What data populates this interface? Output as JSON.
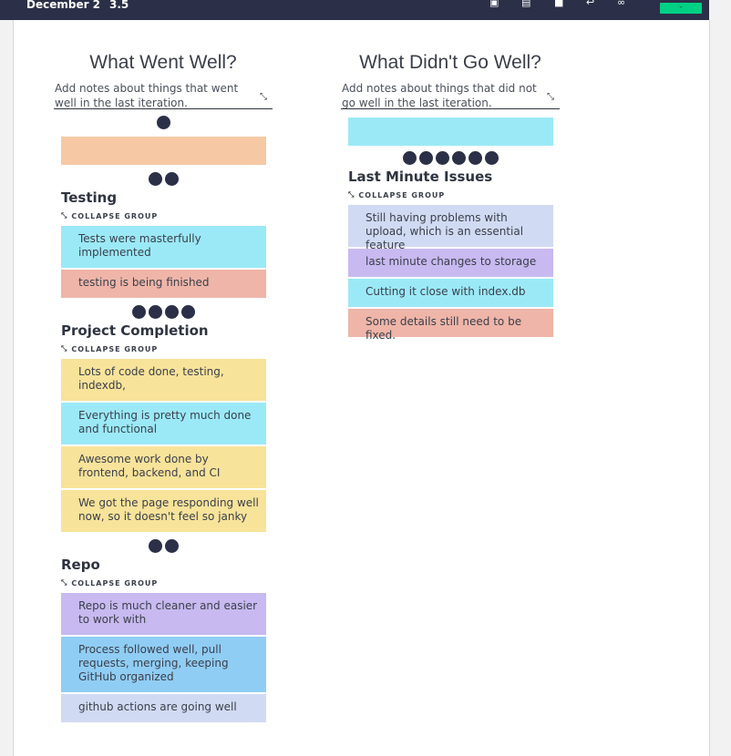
{
  "header": {
    "date": "December 2",
    "score": "3.5",
    "icons": [
      "calendar-icon",
      "clipboard-icon",
      "save-icon",
      "undo-icon",
      "link-icon"
    ],
    "status_label": "-",
    "colors": {
      "bar": "#2b3048",
      "status": "#00d084"
    }
  },
  "columns": [
    {
      "title": "What Went Well?",
      "placeholder": "Add notes about things that went well in the last iteration.",
      "collapse_icon": "collapse-icon",
      "sections": [
        {
          "dots": 1,
          "cards": [
            {
              "text": "",
              "color": "#f6c9a4"
            }
          ]
        },
        {
          "dots": 2,
          "title": "Testing",
          "collapse_label": "COLLAPSE GROUP",
          "cards": [
            {
              "text": "Tests were masterfully implemented",
              "color": "#9be9f7"
            },
            {
              "text": "testing is being finished",
              "color": "#efb5a8"
            }
          ]
        },
        {
          "dots": 4,
          "title": "Project Completion",
          "collapse_label": "COLLAPSE GROUP",
          "cards": [
            {
              "text": "Lots of code done, testing, indexdb,",
              "color": "#f8e39a"
            },
            {
              "text": "Everything is pretty much done and functional",
              "color": "#9be9f7"
            },
            {
              "text": "Awesome work done by frontend, backend, and CI",
              "color": "#f8e39a"
            },
            {
              "text": "We got the page responding well now, so it doesn't feel so janky",
              "color": "#f8e39a"
            }
          ]
        },
        {
          "dots": 2,
          "title": "Repo",
          "collapse_label": "COLLAPSE GROUP",
          "cards": [
            {
              "text": "Repo is much cleaner and easier to work with",
              "color": "#c8b9f0"
            },
            {
              "text": "Process followed well, pull requests, merging, keeping GitHub organized",
              "color": "#90cdf4"
            },
            {
              "text": "github actions are going well",
              "color": "#d0daf2"
            }
          ]
        }
      ]
    },
    {
      "title": "What Didn't Go Well?",
      "placeholder": "Add notes about things that did not go well in the last iteration.",
      "collapse_icon": "collapse-icon",
      "sections": [
        {
          "dots": 0,
          "cards": [
            {
              "text": "",
              "color": "#9be9f7"
            }
          ]
        },
        {
          "dots": 6,
          "title": "Last Minute Issues",
          "collapse_label": "COLLAPSE GROUP",
          "cards": [
            {
              "text": "Still having problems with upload, which is an essential feature",
              "color": "#d0daf2"
            },
            {
              "text": "last minute changes to storage",
              "color": "#c8b9f0"
            },
            {
              "text": "Cutting it close with index.db",
              "color": "#9be9f7"
            },
            {
              "text": "Some details still need to be fixed.",
              "color": "#efb5a8"
            }
          ]
        }
      ]
    }
  ]
}
